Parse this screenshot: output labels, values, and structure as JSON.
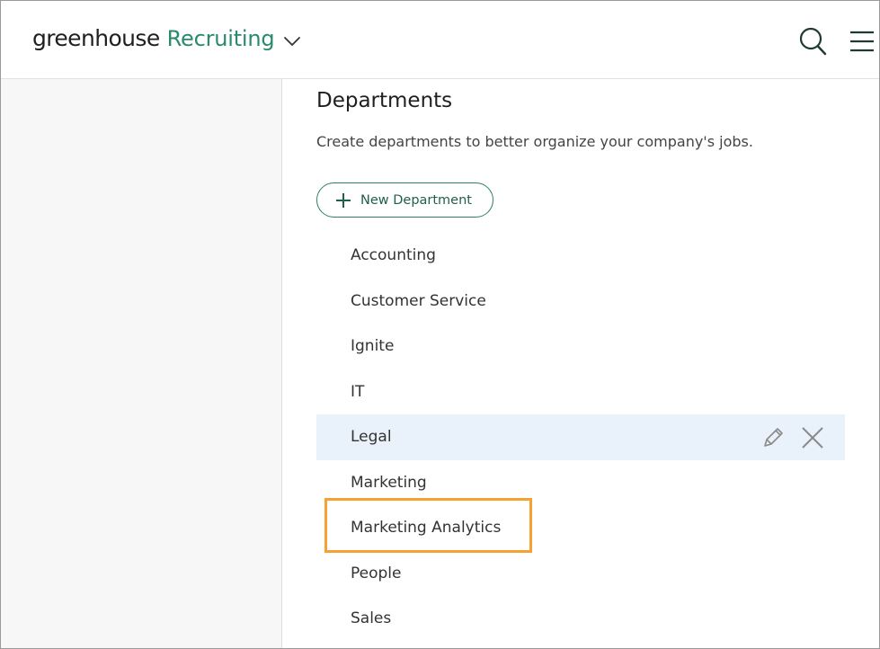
{
  "header": {
    "brand_main": "greenhouse",
    "brand_product": "Recruiting",
    "icons": {
      "brand_menu": "chevron-down-icon",
      "search": "search-icon",
      "menu": "hamburger-menu-icon"
    }
  },
  "page": {
    "title": "Departments",
    "subtitle": "Create departments to better organize your company's jobs.",
    "new_button_label": "New Department",
    "new_button_icon": "plus-icon"
  },
  "departments": [
    {
      "name": "Accounting"
    },
    {
      "name": "Customer Service"
    },
    {
      "name": "Ignite"
    },
    {
      "name": "IT"
    },
    {
      "name": "Legal",
      "hovered": true,
      "actions": [
        "pencil-icon",
        "close-icon"
      ]
    },
    {
      "name": "Marketing"
    },
    {
      "name": "Marketing Analytics",
      "highlighted": true
    },
    {
      "name": "People"
    },
    {
      "name": "Sales"
    }
  ],
  "colors": {
    "brand_green": "#2a8a6d",
    "button_border": "#2d7f68",
    "hover_row": "#e9f1fa",
    "highlight": "#f5a233",
    "sidebar_bg": "#f7f7f7"
  }
}
